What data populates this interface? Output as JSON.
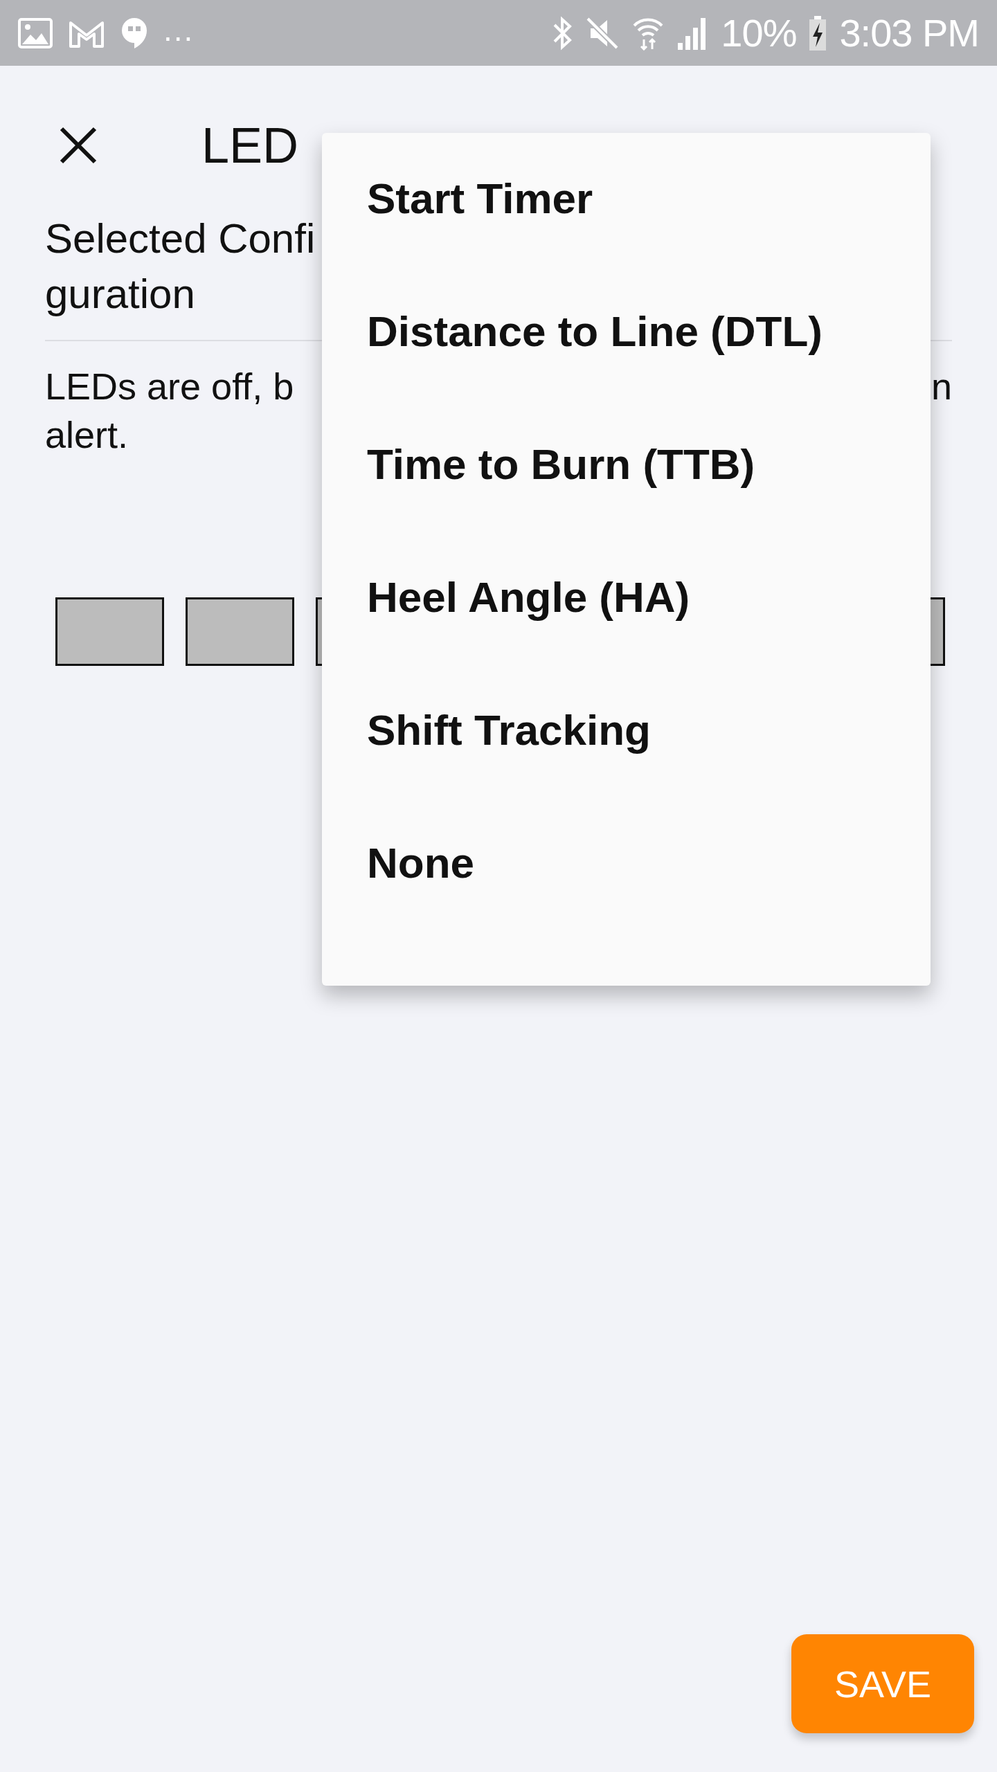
{
  "status_bar": {
    "overflow": "...",
    "battery": "10%",
    "time": "3:03 PM"
  },
  "header": {
    "title": "LED"
  },
  "selected_configuration": {
    "label": "Selected Configuration"
  },
  "description": {
    "line_1_start": "LEDs are off, b",
    "line_1_end": "n",
    "line_2": "alert."
  },
  "leds": [
    {
      "on": false
    },
    {
      "on": false
    },
    {
      "on": false
    },
    {
      "on": false
    }
  ],
  "menu": {
    "items": [
      {
        "label": "Start Timer"
      },
      {
        "label": "Distance to Line (DTL)"
      },
      {
        "label": "Time to Burn (TTB)"
      },
      {
        "label": "Heel Angle (HA)"
      },
      {
        "label": "Shift Tracking"
      },
      {
        "label": "None"
      }
    ]
  },
  "save_button": {
    "label": "SAVE"
  }
}
